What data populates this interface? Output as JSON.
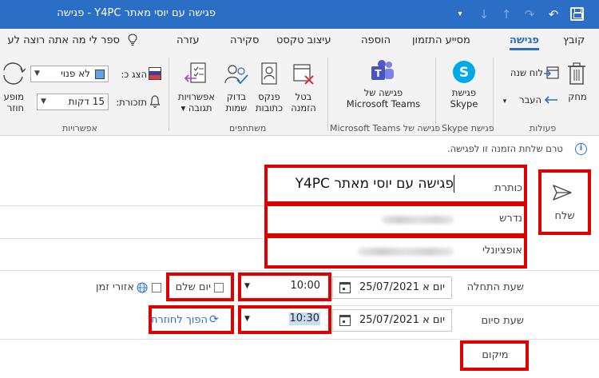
{
  "titlebar": {
    "title": "פגישה עם יוסי מאתר Y4PC  -  פגישה"
  },
  "tabs": {
    "file": "קובץ",
    "meeting": "פגישה",
    "scheduling": "מסייע התזמון",
    "insert": "הוספה",
    "format_text": "עיצוב טקסט",
    "review": "סקירה",
    "help": "עזרה",
    "tell_me": "ספר לי מה אתה רוצה לע"
  },
  "ribbon": {
    "delete": "מחק",
    "calendar": "לוח שנה",
    "forward": "העבר",
    "actions_group": "פעולות",
    "skype_line1": "פגישת",
    "skype_line2": "Skype",
    "skype_group": "פגישת Skype",
    "teams_line1": "פגישה של",
    "teams_line2": "Microsoft Teams",
    "teams_group": "פגישה של Microsoft Teams",
    "cancel_line1": "בטל",
    "cancel_line2": "הזמנה",
    "address_line1": "פנקס",
    "address_line2": "כתובות",
    "check_line1": "בדוק",
    "check_line2": "שמות",
    "response_line1": "אפשרויות",
    "response_line2": "תגובה",
    "attendees_group": "משתתפים",
    "show_as_label": "הצג כ:",
    "show_as_value": "לא פנוי",
    "reminder_label": "תזכורת:",
    "reminder_value": "15 דקות",
    "recur_line1": "מופע",
    "recur_line2": "חוזר",
    "options_group": "אפשרויות"
  },
  "form": {
    "info": "טרם שלחת הזמנה זו לפגישה.",
    "send": "שלח",
    "title_label": "כותרת",
    "title_value": "פגישה עם יוסי מאתר Y4PC",
    "required_label": "נדרש",
    "optional_label": "אופציונלי",
    "start_label": "שעת התחלה",
    "start_date": "יום א 25/07/2021",
    "start_time": "10:00",
    "end_label": "שעת סיום",
    "end_date": "יום א 25/07/2021",
    "end_time": "10:30",
    "all_day": "יום שלם",
    "time_zones": "אזורי זמן",
    "make_recurring": "הפוך לחוזרת",
    "location": "מיקום"
  },
  "colors": {
    "titlebar": "#2b6ec5",
    "highlight": "#e00000",
    "accent": "#2b6ec5"
  }
}
